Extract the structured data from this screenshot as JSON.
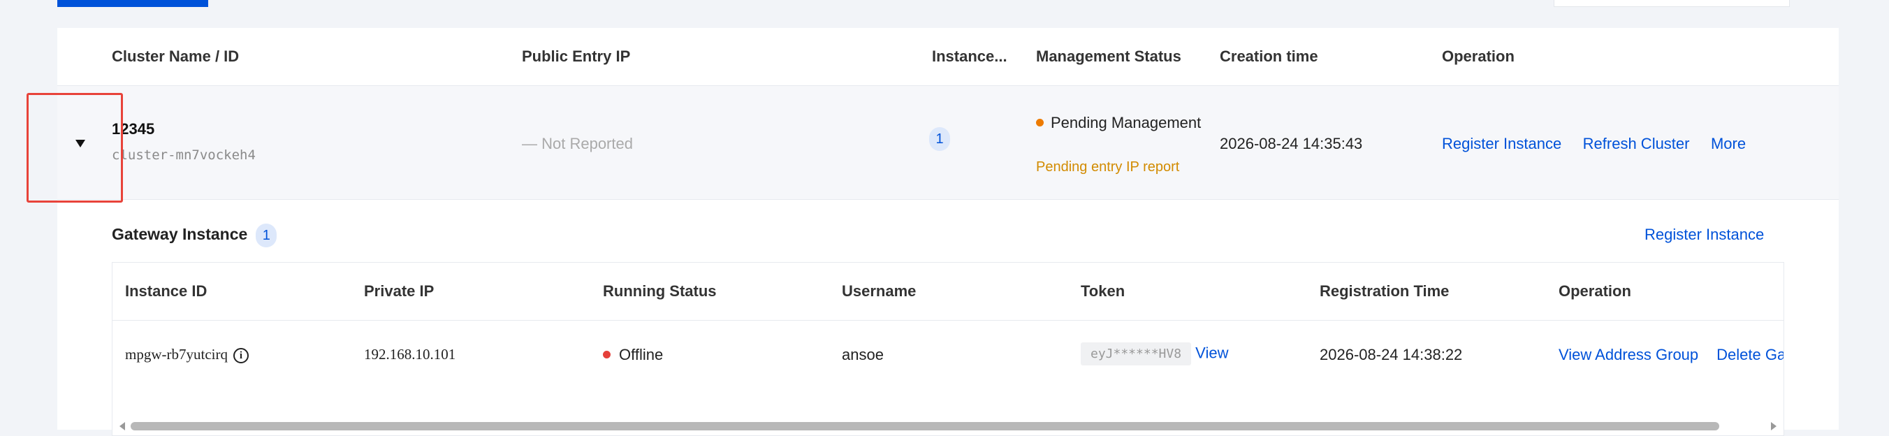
{
  "cluster_table": {
    "headers": {
      "name": "Cluster Name / ID",
      "public_ip": "Public Entry IP",
      "instances": "Instance...",
      "mgmt_status": "Management Status",
      "created": "Creation time",
      "operation": "Operation"
    },
    "row": {
      "name": "12345",
      "id": "cluster-mn7vockeh4",
      "public_ip": "— Not Reported",
      "instance_count": "1",
      "mgmt_status": "Pending Management",
      "mgmt_status_color": "#ed7b00",
      "mgmt_sub": "Pending entry IP report",
      "created": "2026-08-24 14:35:43",
      "ops": {
        "register": "Register Instance",
        "refresh": "Refresh Cluster",
        "more": "More"
      }
    }
  },
  "gateway": {
    "title": "Gateway Instance",
    "count": "1",
    "register": "Register Instance",
    "headers": {
      "id": "Instance ID",
      "private_ip": "Private IP",
      "running_status": "Running Status",
      "username": "Username",
      "token": "Token",
      "reg_time": "Registration Time",
      "operation": "Operation"
    },
    "row": {
      "id": "mpgw-rb7yutcirq",
      "private_ip": "192.168.10.101",
      "running_status": "Offline",
      "status_color": "#e5403a",
      "username": "ansoe",
      "token": "eyJ******HV8",
      "token_view": "View",
      "reg_time": "2026-08-24 14:38:22",
      "ops": {
        "view_address_group": "View Address Group",
        "delete": "Delete Ga"
      }
    }
  },
  "colors": {
    "accent": "#0052d9",
    "highlight_box": "#e8433a"
  }
}
